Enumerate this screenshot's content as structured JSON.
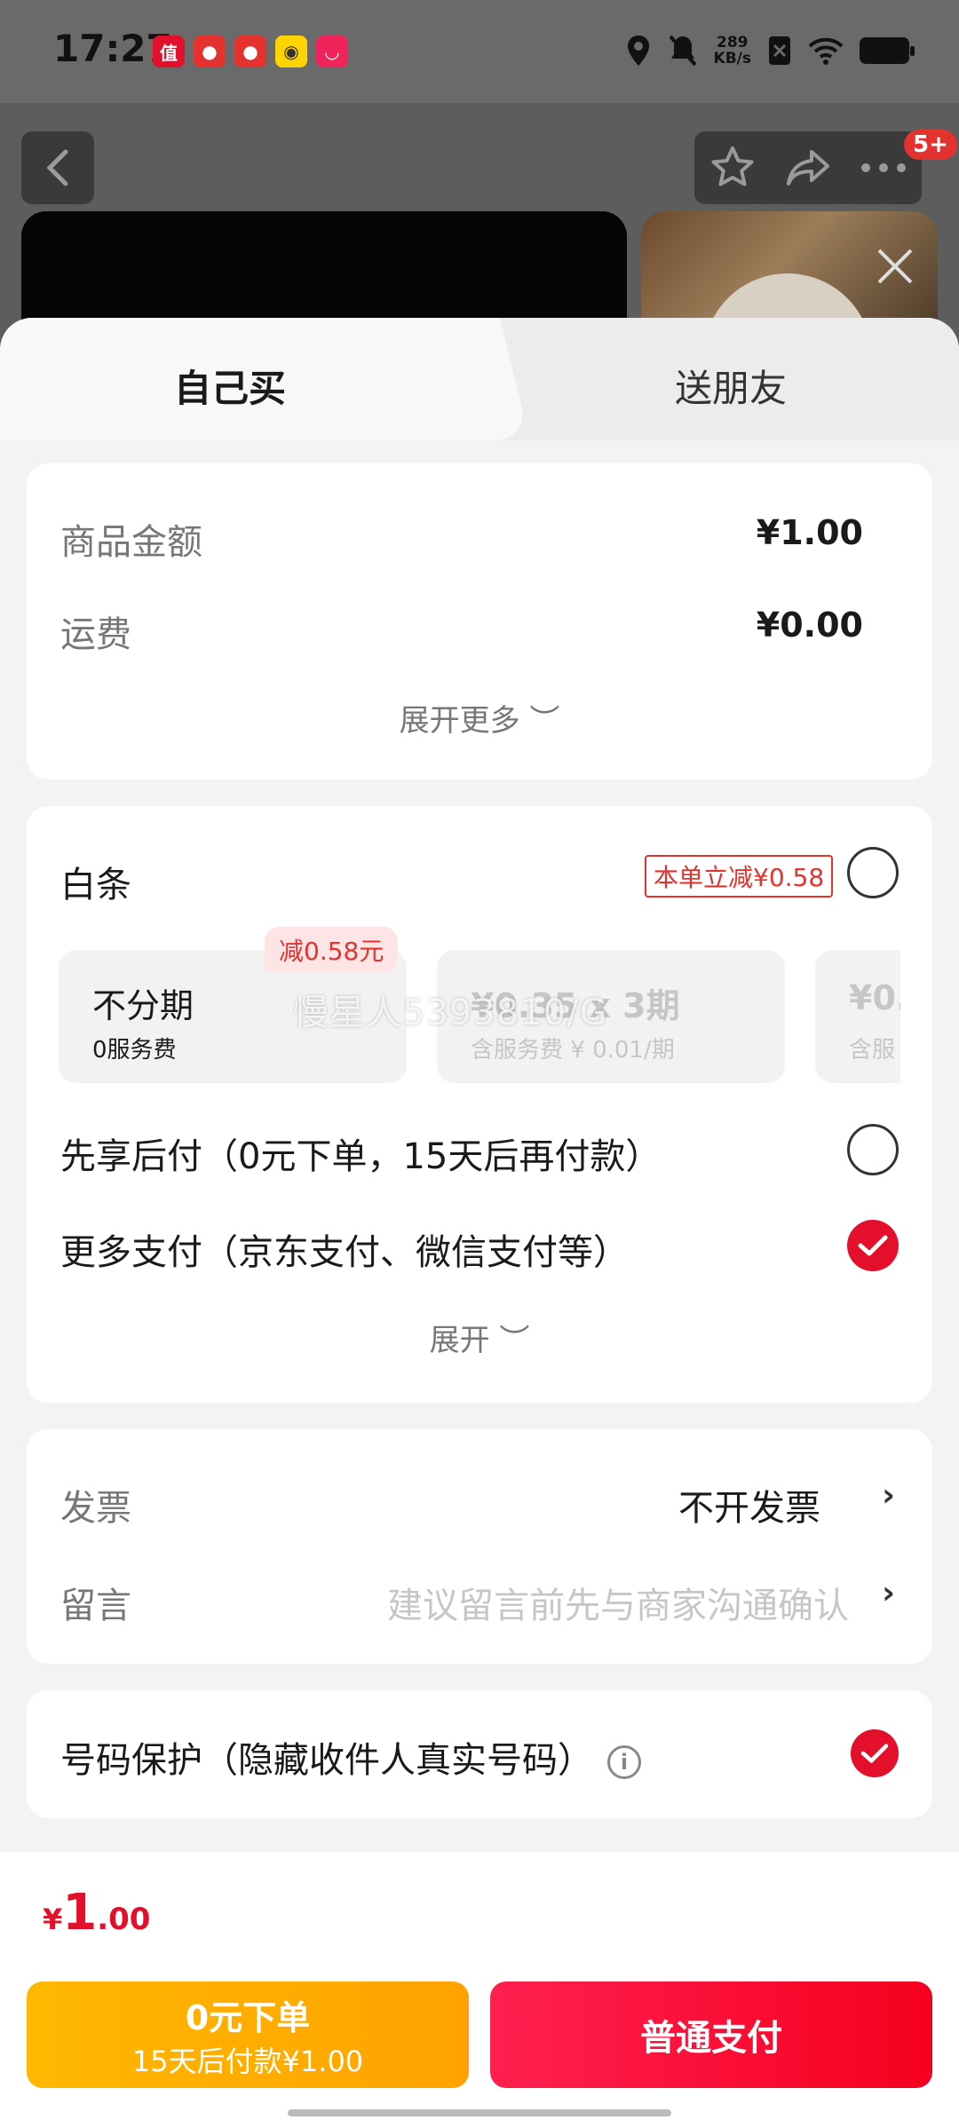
{
  "status_bar": {
    "time": "17:27",
    "net_speed": "289",
    "net_unit": "KB/s"
  },
  "top_bar": {
    "badge": "5+"
  },
  "tabs": {
    "self": "自己买",
    "friend": "送朋友"
  },
  "summary": {
    "goods_label": "商品金额",
    "goods_value": "¥1.00",
    "shipping_label": "运费",
    "shipping_value": "¥0.00",
    "expand_more": "展开更多 ︶"
  },
  "baitiao": {
    "label": "白条",
    "promo": "本单立减¥0.58",
    "discount_badge": "减0.58元",
    "watermark": "慢星人5393810/G",
    "plans": [
      {
        "title": "不分期",
        "sub": "0服务费"
      },
      {
        "title": "¥0.35 x 3期",
        "sub": "含服务费 ¥ 0.01/期"
      },
      {
        "title": "¥0.",
        "sub": "含服"
      }
    ]
  },
  "payment": {
    "pay_later": "先享后付（0元下单，15天后再付款）",
    "more_pay": "更多支付（京东支付、微信支付等）",
    "expand": "展开 ︶"
  },
  "invoice": {
    "label": "发票",
    "value": "不开发票"
  },
  "message": {
    "label": "留言",
    "placeholder": "建议留言前先与商家沟通确认"
  },
  "privacy": {
    "label": "号码保护（隐藏收件人真实号码）"
  },
  "footer": {
    "currency": "¥",
    "total_int": "1",
    "total_dec": ".00",
    "btn_later_line1": "0元下单",
    "btn_later_line2": "15天后付款¥1.00",
    "btn_pay": "普通支付"
  },
  "colors": {
    "accent_red": "#e4102b",
    "later_yellow": "#ffb800"
  }
}
